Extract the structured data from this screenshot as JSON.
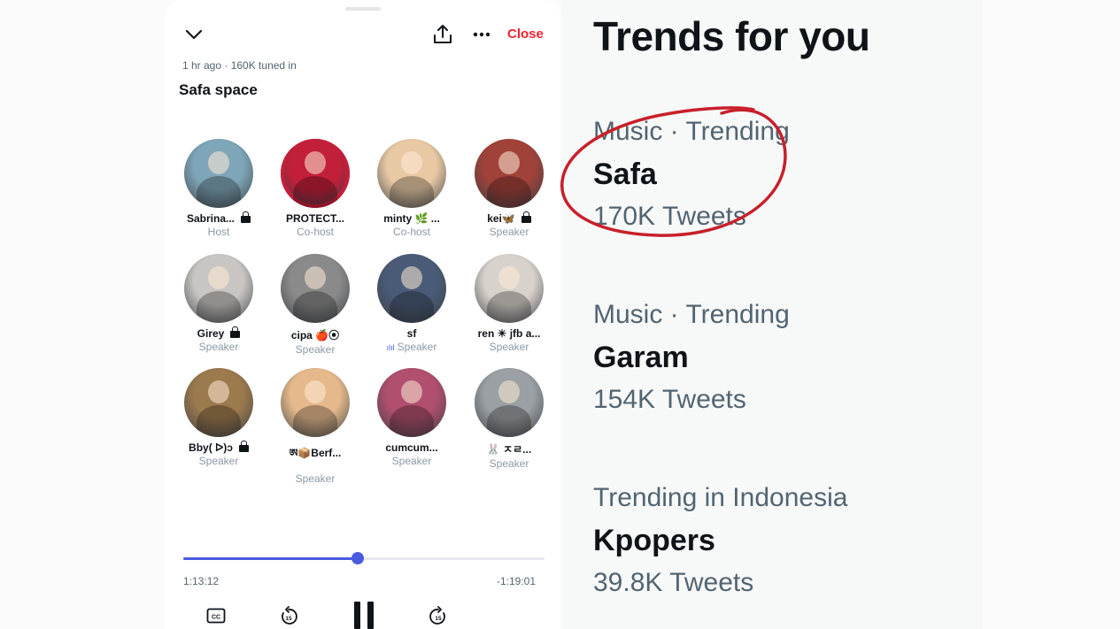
{
  "space": {
    "close_label": "Close",
    "meta": "1 hr ago · 160K tuned in",
    "title": "Safa space",
    "participants": [
      {
        "name": "Sabrina...",
        "role": "Host",
        "locked": true,
        "color": "#7fa6b8"
      },
      {
        "name": "PROTECT...",
        "role": "Co-host",
        "locked": false,
        "color": "#c21f3a"
      },
      {
        "name": "minty 🌿 ...",
        "role": "Co-host",
        "locked": false,
        "color": "#e8c9a4"
      },
      {
        "name": "kei🦋",
        "role": "Speaker",
        "locked": true,
        "color": "#a1423a"
      },
      {
        "name": "Girey",
        "role": "Speaker",
        "locked": true,
        "color": "#c9c5c2"
      },
      {
        "name": "cipa 🍎⦿",
        "role": "Speaker",
        "locked": false,
        "color": "#8a8a8a"
      },
      {
        "name": "sf",
        "role": "Speaker",
        "locked": false,
        "color": "#4a5b77"
      },
      {
        "name": "ren ☀ jfb a...",
        "role": "Speaker",
        "locked": false,
        "color": "#d8d2cc"
      },
      {
        "name": "Bby( ᐅ)ↄ",
        "role": "Speaker",
        "locked": true,
        "color": "#9b7a4e"
      },
      {
        "name": "ཨ📦Berf...",
        "role": "Speaker",
        "locked": false,
        "color": "#e5b98c"
      },
      {
        "name": "cumcum...",
        "role": "Speaker",
        "locked": false,
        "color": "#b04f6e"
      },
      {
        "name": "🐰 ㅈㄹ...",
        "role": "Speaker",
        "locked": false,
        "color": "#9aa0a3"
      }
    ],
    "speaking_indicator": "ılıl",
    "progress": 0.482,
    "elapsed": "1:13:12",
    "remaining": "-1:19:01",
    "accent_color": "#4b5be0",
    "close_color": "#f4212e"
  },
  "trends": {
    "title": "Trends for you",
    "items": [
      {
        "context": "Music · Trending",
        "name": "Safa",
        "count": "170K Tweets",
        "highlighted": true
      },
      {
        "context": "Music · Trending",
        "name": "Garam",
        "count": "154K Tweets",
        "highlighted": false
      },
      {
        "context": "Trending in Indonesia",
        "name": "Kpopers",
        "count": "39.8K Tweets",
        "highlighted": false
      }
    ],
    "annotation_color": "#c8202a"
  }
}
